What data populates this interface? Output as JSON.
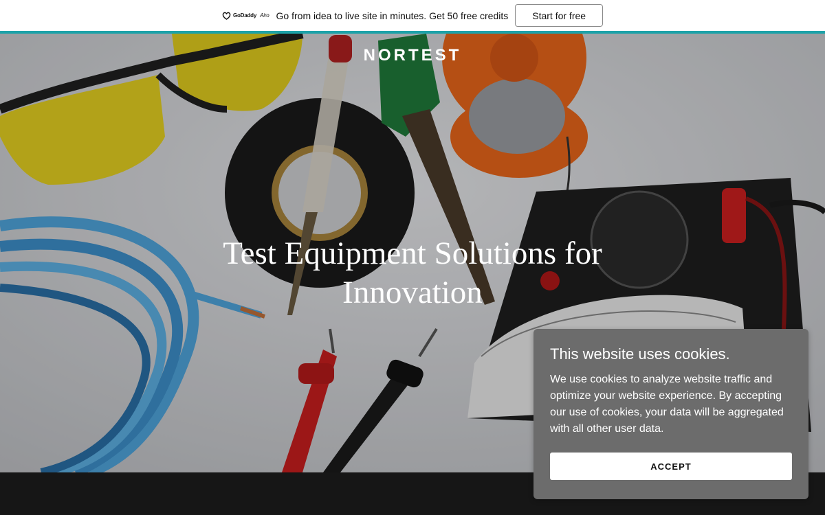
{
  "promo": {
    "brand": "GoDaddy",
    "brand_product": "Airo",
    "message": "Go from idea to live site in minutes. Get 50 free credits",
    "cta_label": "Start for free"
  },
  "hero": {
    "site_title": "NORTEST",
    "heading": "Test Equipment Solutions for Innovation"
  },
  "cookie": {
    "title": "This website uses cookies.",
    "body": "We use cookies to analyze website traffic and optimize your website experience. By accepting our use of cookies, your data will be aggregated with all other user data.",
    "accept_label": "ACCEPT"
  },
  "colors": {
    "accent_bar": "#1da2a8",
    "cookie_panel": "#6c6c6c",
    "dark_strip": "#161616"
  }
}
